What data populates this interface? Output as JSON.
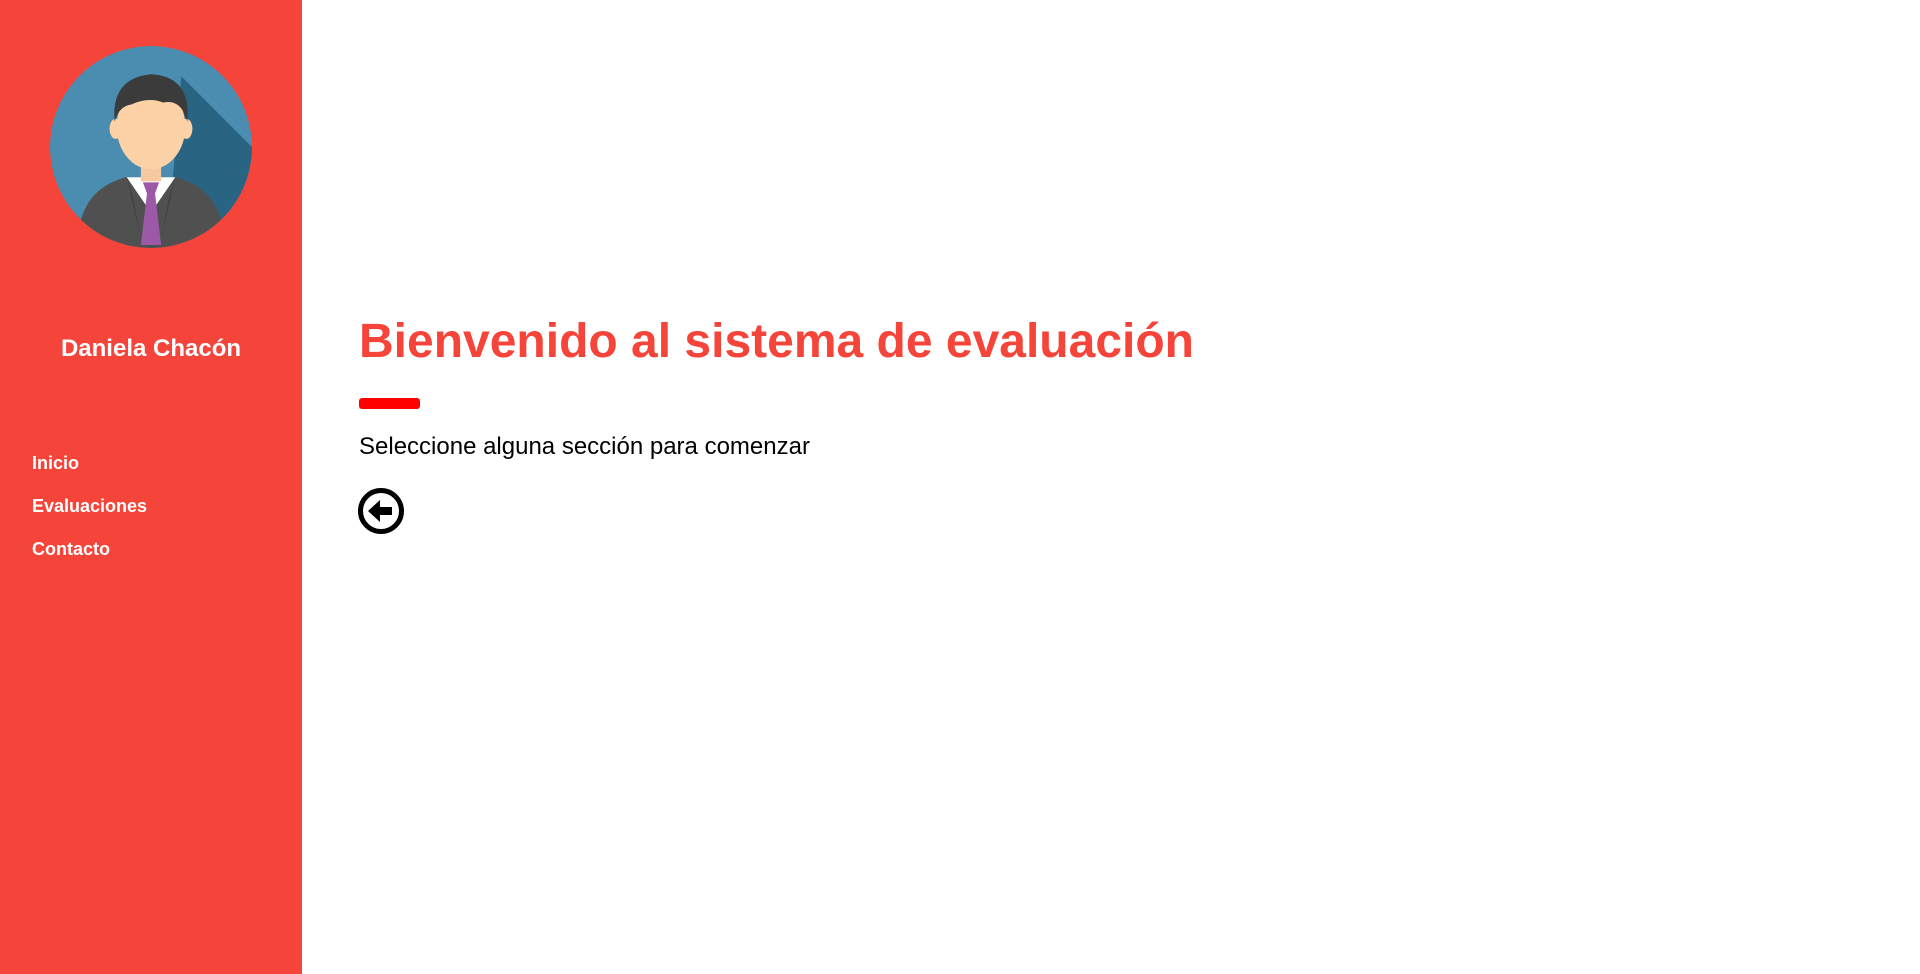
{
  "colors": {
    "sidebar_background": "#f5443a",
    "title_color": "#f5443a",
    "underline_color": "#ff0000",
    "text_color": "#000000"
  },
  "sidebar": {
    "avatar_icon": "businessman-avatar-icon",
    "user_name": "Daniela Chacón",
    "nav_items": [
      {
        "label": "Inicio"
      },
      {
        "label": "Evaluaciones"
      },
      {
        "label": "Contacto"
      }
    ]
  },
  "main": {
    "title": "Bienvenido al sistema de evaluación",
    "subtitle": "Seleccione alguna sección para comenzar",
    "back_icon": "arrow-circle-left-icon"
  }
}
